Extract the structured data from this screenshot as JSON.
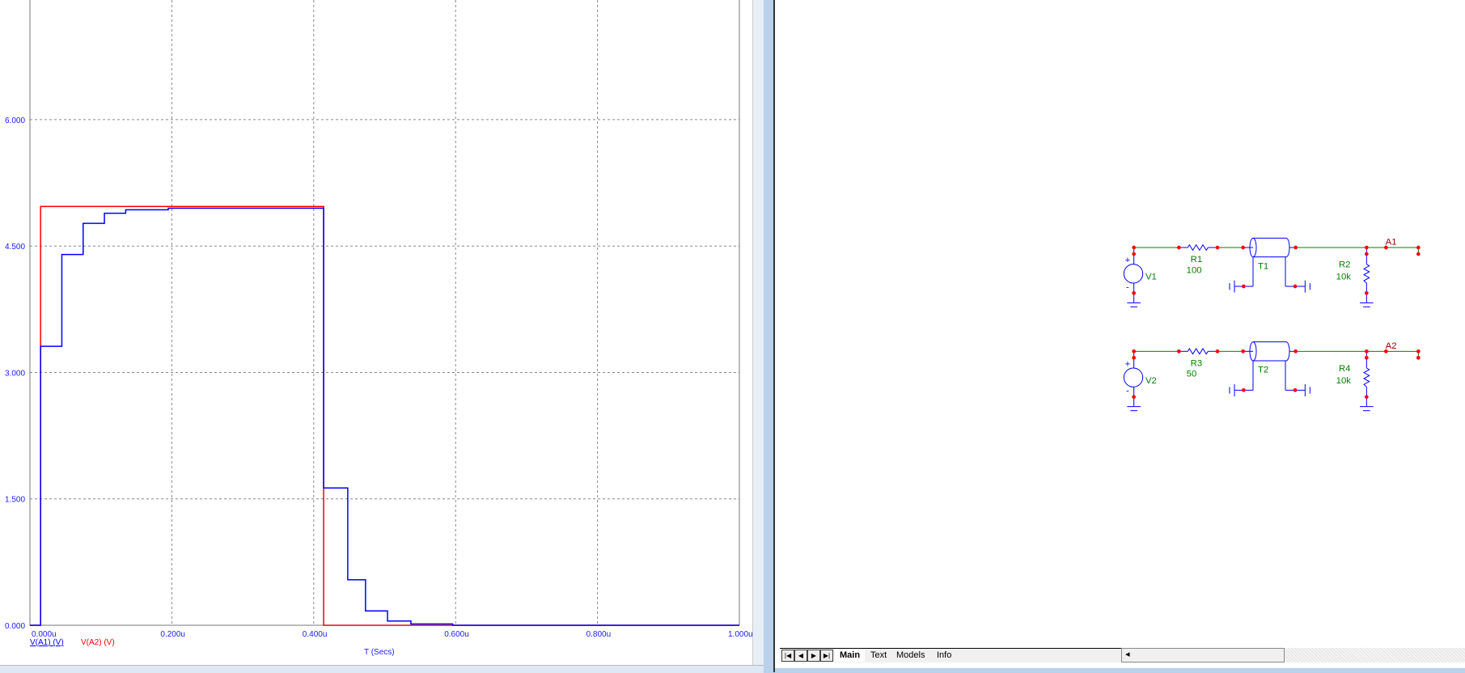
{
  "chart_data": {
    "type": "line",
    "xlabel": "T (Secs)",
    "xlim": [
      0,
      1.0
    ],
    "ylim": [
      0,
      7.42
    ],
    "x_ticks": [
      "0.000u",
      "0.200u",
      "0.400u",
      "0.600u",
      "0.800u",
      "1.000u"
    ],
    "x_tick_values": [
      0,
      0.2,
      0.4,
      0.6,
      0.8,
      1.0
    ],
    "y_ticks": [
      "0.000",
      "1.500",
      "3.000",
      "4.500",
      "6.000"
    ],
    "y_tick_values": [
      0,
      1.5,
      3,
      4.5,
      6
    ],
    "grid": true,
    "series": [
      {
        "name": "V(A1) (V)",
        "color": "#0000ff",
        "points": [
          [
            0,
            0
          ],
          [
            0.015,
            0
          ],
          [
            0.015,
            3.31
          ],
          [
            0.045,
            3.31
          ],
          [
            0.045,
            4.4
          ],
          [
            0.075,
            4.4
          ],
          [
            0.075,
            4.77
          ],
          [
            0.105,
            4.77
          ],
          [
            0.105,
            4.89
          ],
          [
            0.135,
            4.89
          ],
          [
            0.135,
            4.93
          ],
          [
            0.195,
            4.93
          ],
          [
            0.195,
            4.95
          ],
          [
            0.414,
            4.95
          ],
          [
            0.414,
            1.63
          ],
          [
            0.448,
            1.63
          ],
          [
            0.448,
            0.54
          ],
          [
            0.473,
            0.54
          ],
          [
            0.473,
            0.17
          ],
          [
            0.504,
            0.17
          ],
          [
            0.504,
            0.05
          ],
          [
            0.537,
            0.05
          ],
          [
            0.537,
            0.015
          ],
          [
            0.596,
            0.015
          ],
          [
            0.596,
            0
          ],
          [
            1.0,
            0
          ]
        ]
      },
      {
        "name": "V(A2) (V)",
        "color": "#ff0000",
        "points": [
          [
            0,
            0
          ],
          [
            0.015,
            0
          ],
          [
            0.015,
            4.97
          ],
          [
            0.414,
            4.97
          ],
          [
            0.414,
            0
          ],
          [
            1.0,
            0
          ]
        ]
      }
    ]
  },
  "schematic": {
    "rows": [
      {
        "source": "V1",
        "resistor": "R1",
        "resistor_value": "100",
        "tline": "T1",
        "load": "R2",
        "load_value": "10k",
        "node": "A1"
      },
      {
        "source": "V2",
        "resistor": "R3",
        "resistor_value": "50",
        "tline": "T2",
        "load": "R4",
        "load_value": "10k",
        "node": "A2"
      }
    ],
    "plus": "+",
    "minus": "-"
  },
  "tabs": [
    {
      "label": "Main",
      "active": true
    },
    {
      "label": "Text"
    },
    {
      "label": "Models"
    },
    {
      "label": "Info"
    }
  ],
  "nav": [
    "|◀",
    "◀",
    "▶",
    "▶|"
  ],
  "scroll_left": "◂"
}
